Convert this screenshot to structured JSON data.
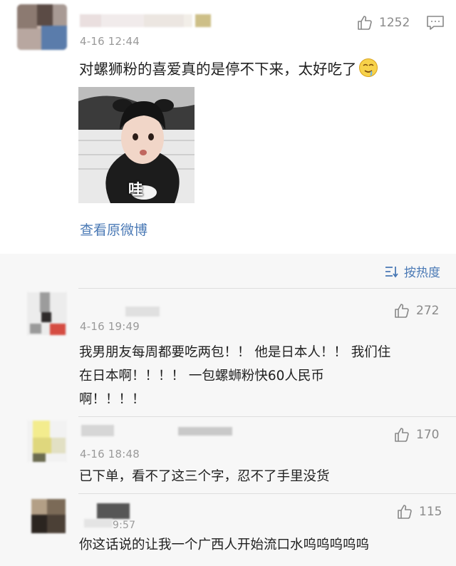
{
  "post": {
    "time": "4-16 12:44",
    "likes": "1252",
    "text": "对螺狮粉的喜爱真的是停不下来，太好吃了",
    "image_caption": "哇",
    "view_original_label": "查看原微博"
  },
  "sort": {
    "label": "按热度"
  },
  "comments": [
    {
      "time": "4-16 19:49",
      "likes": "272",
      "lines": [
        "我男朋友每周都要吃两包！！ 他是日本人！！ 我们住",
        "在日本啊！！！！ 一包螺蛳粉快60人民币",
        "啊！！！！"
      ]
    },
    {
      "time": "4-16 18:48",
      "likes": "170",
      "lines": [
        "已下单，看不了这三个字，忍不了手里没货"
      ]
    },
    {
      "time": "9:57",
      "likes": "115",
      "lines": [
        "你这话说的让我一个广西人开始流口水呜呜呜呜呜"
      ]
    }
  ],
  "icons": {
    "like": "thumbs-up-icon",
    "comment": "comment-icon",
    "sort": "sort-icon",
    "emoji": "drooling-emoji-icon"
  },
  "colors": {
    "link": "#4a79b5",
    "meta": "#9a9a9a",
    "comments_bg": "#f7f7f7"
  }
}
